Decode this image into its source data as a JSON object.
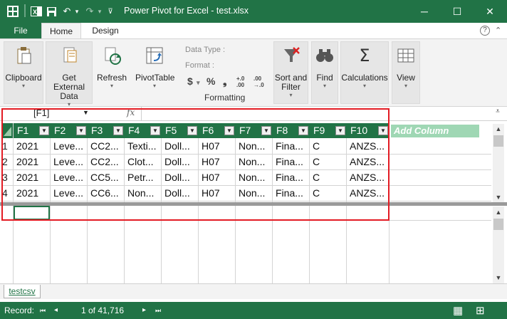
{
  "window": {
    "title": "Power Pivot for Excel - test.xlsx",
    "minimize": "─",
    "maximize": "☐",
    "close": "✕"
  },
  "quick_access": {
    "undo": "↶",
    "undo_dd": "▾",
    "redo": "↷",
    "redo_dd": "▾",
    "customize": "⊽"
  },
  "tabs": [
    {
      "label": "File"
    },
    {
      "label": "Home"
    },
    {
      "label": "Design"
    }
  ],
  "tabs_right": {
    "help": "?",
    "collapse": "⌃"
  },
  "ribbon": {
    "clipboard": {
      "label": "Clipboard",
      "icon": "clipboard-icon"
    },
    "get_external_data": {
      "label": "Get External Data",
      "icon": "database-icon"
    },
    "refresh": {
      "label": "Refresh",
      "icon": "refresh-icon"
    },
    "pivottable": {
      "label": "PivotTable",
      "icon": "pivottable-icon"
    },
    "formatting": {
      "group_label": "Formatting",
      "data_type": "Data Type :",
      "format": "Format :",
      "currency": "$",
      "percent": "%",
      "comma": "❟",
      "inc_decimal": "+.0 .00",
      "dec_decimal": ".00 →.0"
    },
    "sort_filter": {
      "label": "Sort and Filter",
      "icon": "sort-filter-icon"
    },
    "find": {
      "label": "Find",
      "icon": "binoculars-icon"
    },
    "calculations": {
      "label": "Calculations",
      "icon": "sigma-icon",
      "symbol": "Σ"
    },
    "view": {
      "label": "View",
      "icon": "view-grid-icon"
    },
    "dropdown_glyph": "▾"
  },
  "formula_bar": {
    "name_box": "[F1]",
    "name_box_dd": "▼",
    "fx": "fx",
    "value": "",
    "expand": "⩡"
  },
  "table": {
    "columns": [
      "F1",
      "F2",
      "F3",
      "F4",
      "F5",
      "F6",
      "F7",
      "F8",
      "F9",
      "F10"
    ],
    "filter_glyph": "▼",
    "add_column": "Add Column",
    "row_numbers": [
      "1",
      "2",
      "3",
      "4"
    ],
    "rows": [
      [
        "2021",
        "Leve...",
        "CC2...",
        "Texti...",
        "Doll...",
        "H07",
        "Non...",
        "Fina...",
        "C",
        "ANZS..."
      ],
      [
        "2021",
        "Leve...",
        "CC2...",
        "Clot...",
        "Doll...",
        "H07",
        "Non...",
        "Fina...",
        "C",
        "ANZS..."
      ],
      [
        "2021",
        "Leve...",
        "CC5...",
        "Petr...",
        "Doll...",
        "H07",
        "Non...",
        "Fina...",
        "C",
        "ANZS..."
      ],
      [
        "2021",
        "Leve...",
        "CC6...",
        "Non...",
        "Doll...",
        "H07",
        "Non...",
        "Fina...",
        "C",
        "ANZS..."
      ]
    ]
  },
  "scroll": {
    "up": "▲",
    "down": "▼"
  },
  "sheet_tab": "testcsv",
  "status_bar": {
    "record_label": "Record:",
    "first": "⏮",
    "prev": "◂",
    "position": "1 of 41,716",
    "next": "▸",
    "last": "⏭",
    "grid_view": "▦",
    "diagram_view": "⊞"
  },
  "colors": {
    "accent": "#217346",
    "add_column": "#9fd7b4",
    "highlight_box": "#e31b23"
  }
}
